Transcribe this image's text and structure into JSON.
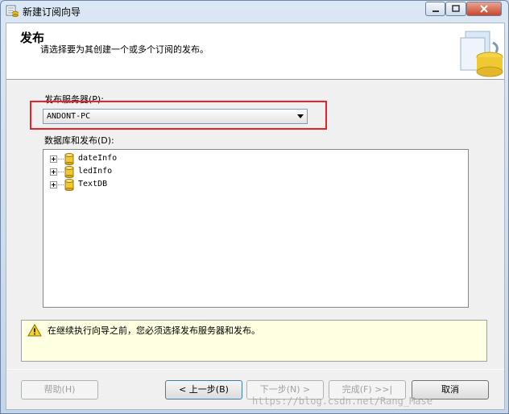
{
  "window": {
    "title": "新建订阅向导"
  },
  "header": {
    "title": "发布",
    "subtitle": "请选择要为其创建一个或多个订阅的发布。"
  },
  "publisher": {
    "label": "发布服务器(P):",
    "selected_value": "ANDONT-PC"
  },
  "databases": {
    "label": "数据库和发布(D):",
    "items": [
      {
        "label": "dateInfo"
      },
      {
        "label": "ledInfo"
      },
      {
        "label": "TextDB"
      }
    ]
  },
  "warning": {
    "text": "在继续执行向导之前，您必须选择发布服务器和发布。"
  },
  "buttons": {
    "help": "帮助(H)",
    "back": "< 上一步(B)",
    "next": "下一步(N) >",
    "finish": "完成(F) >>|",
    "cancel": "取消"
  },
  "watermark": "https://blog.csdn.net/Rang_Mase",
  "colors": {
    "highlight_border": "#e8212a",
    "warning_background": "#ffffe1"
  }
}
